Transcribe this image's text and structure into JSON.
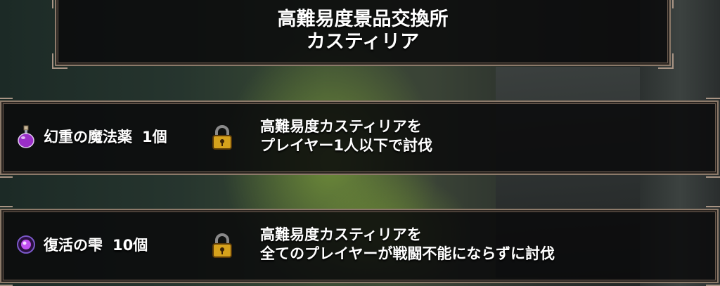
{
  "header": {
    "title_line1": "高難易度景品交換所",
    "title_line2": "カスティリア"
  },
  "rewards": [
    {
      "item_name": "幻重の魔法薬",
      "quantity": "1個",
      "icon": "purple-potion-icon",
      "locked": true,
      "condition_line1": "高難易度カスティリアを",
      "condition_line2": "プレイヤー1人以下で討伐"
    },
    {
      "item_name": "復活の雫",
      "quantity": "10個",
      "icon": "purple-orb-icon",
      "locked": true,
      "condition_line1": "高難易度カスティリアを",
      "condition_line2": "全てのプレイヤーが戦闘不能にならずに討伐"
    }
  ],
  "colors": {
    "panel_border": "#8c7a6a",
    "panel_fill": "#0a0a0c",
    "text": "#ffffff",
    "lock_gold": "#d6a21c"
  }
}
